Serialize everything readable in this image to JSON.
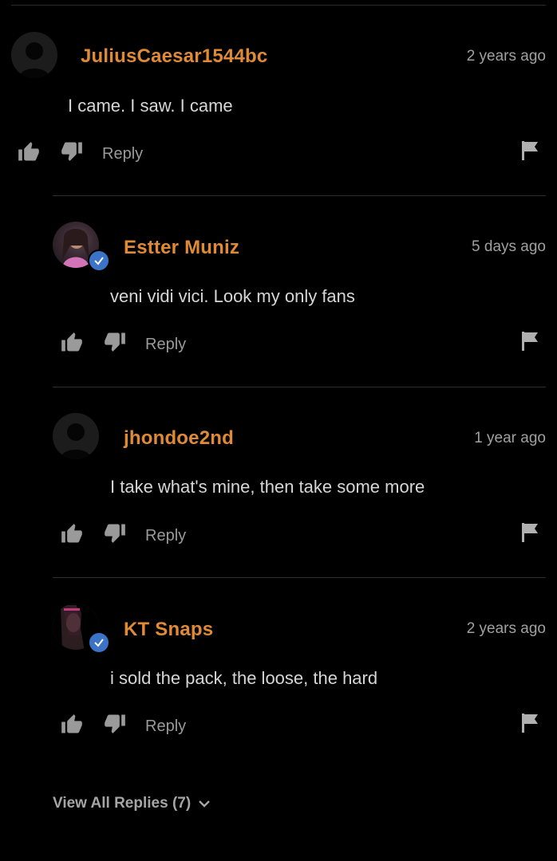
{
  "comments": [
    {
      "username": "JuliusCaesar1544bc",
      "timestamp": "2 years ago",
      "text": "I came. I saw. I came",
      "reply_label": "Reply",
      "verified": false
    },
    {
      "username": "Estter Muniz",
      "timestamp": "5 days ago",
      "text": "veni vidi vici. Look my only fans",
      "reply_label": "Reply",
      "verified": true
    },
    {
      "username": "jhondoe2nd",
      "timestamp": "1 year ago",
      "text": "I take what's mine, then take some more",
      "reply_label": "Reply",
      "verified": false
    },
    {
      "username": "KT Snaps",
      "timestamp": "2 years ago",
      "text": "i sold the pack, the loose, the hard",
      "reply_label": "Reply",
      "verified": true
    }
  ],
  "view_all_replies": "View All Replies (7)",
  "colors": {
    "username": "#e08a35",
    "verified_badge": "#3b73c7",
    "background": "#000000"
  },
  "icons": [
    "thumbs-up-icon",
    "thumbs-down-icon",
    "flag-icon",
    "chevron-down-icon",
    "verified-check-icon",
    "default-avatar-icon"
  ]
}
